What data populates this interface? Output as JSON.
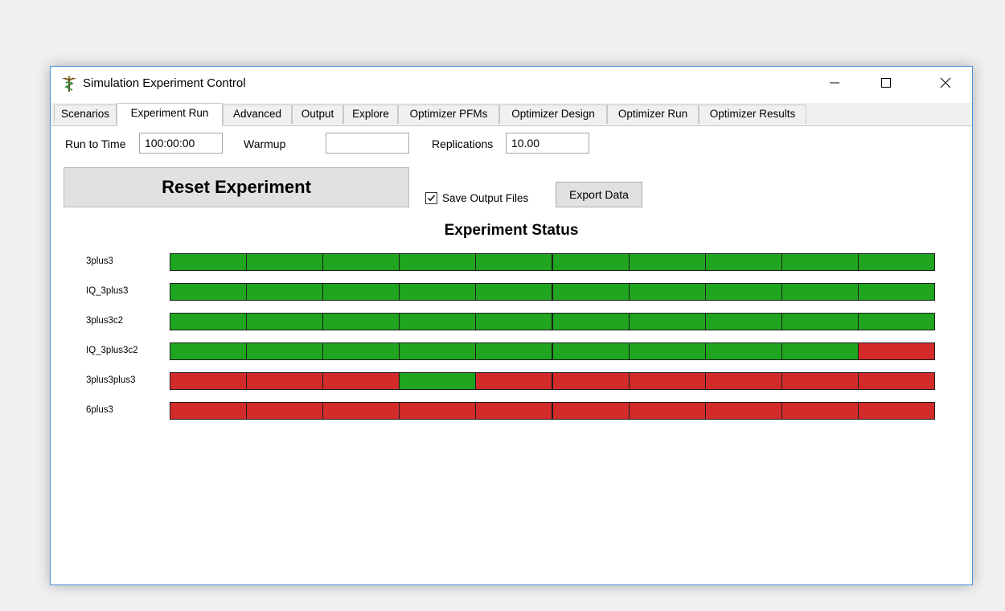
{
  "window": {
    "title": "Simulation Experiment Control",
    "icon": "caduceus-icon"
  },
  "tabs": [
    {
      "label": "Scenarios",
      "active": false
    },
    {
      "label": "Experiment Run",
      "active": true
    },
    {
      "label": "Advanced",
      "active": false
    },
    {
      "label": "Output",
      "active": false
    },
    {
      "label": "Explore",
      "active": false
    },
    {
      "label": "Optimizer PFMs",
      "active": false
    },
    {
      "label": "Optimizer Design",
      "active": false
    },
    {
      "label": "Optimizer Run",
      "active": false
    },
    {
      "label": "Optimizer Results",
      "active": false
    }
  ],
  "run_settings": {
    "run_to_time_label": "Run to Time",
    "run_to_time_value": "100:00:00",
    "warmup_label": "Warmup",
    "warmup_value": "",
    "replications_label": "Replications",
    "replications_value": "10.00"
  },
  "actions": {
    "reset_label": "Reset Experiment",
    "save_output_label": "Save Output Files",
    "save_output_checked": true,
    "export_label": "Export Data"
  },
  "status": {
    "title": "Experiment Status",
    "colors": {
      "complete": "#1fa51f",
      "incomplete": "#d32a2a"
    },
    "scenarios": [
      {
        "name": "3plus3",
        "replications": [
          "complete",
          "complete",
          "complete",
          "complete",
          "complete",
          "complete",
          "complete",
          "complete",
          "complete",
          "complete"
        ]
      },
      {
        "name": "IQ_3plus3",
        "replications": [
          "complete",
          "complete",
          "complete",
          "complete",
          "complete",
          "complete",
          "complete",
          "complete",
          "complete",
          "complete"
        ]
      },
      {
        "name": "3plus3c2",
        "replications": [
          "complete",
          "complete",
          "complete",
          "complete",
          "complete",
          "complete",
          "complete",
          "complete",
          "complete",
          "complete"
        ]
      },
      {
        "name": "IQ_3plus3c2",
        "replications": [
          "complete",
          "complete",
          "complete",
          "complete",
          "complete",
          "complete",
          "complete",
          "complete",
          "complete",
          "incomplete"
        ]
      },
      {
        "name": "3plus3plus3",
        "replications": [
          "incomplete",
          "incomplete",
          "incomplete",
          "complete",
          "incomplete",
          "incomplete",
          "incomplete",
          "incomplete",
          "incomplete",
          "incomplete"
        ]
      },
      {
        "name": "6plus3",
        "replications": [
          "incomplete",
          "incomplete",
          "incomplete",
          "incomplete",
          "incomplete",
          "incomplete",
          "incomplete",
          "incomplete",
          "incomplete",
          "incomplete"
        ]
      }
    ]
  }
}
